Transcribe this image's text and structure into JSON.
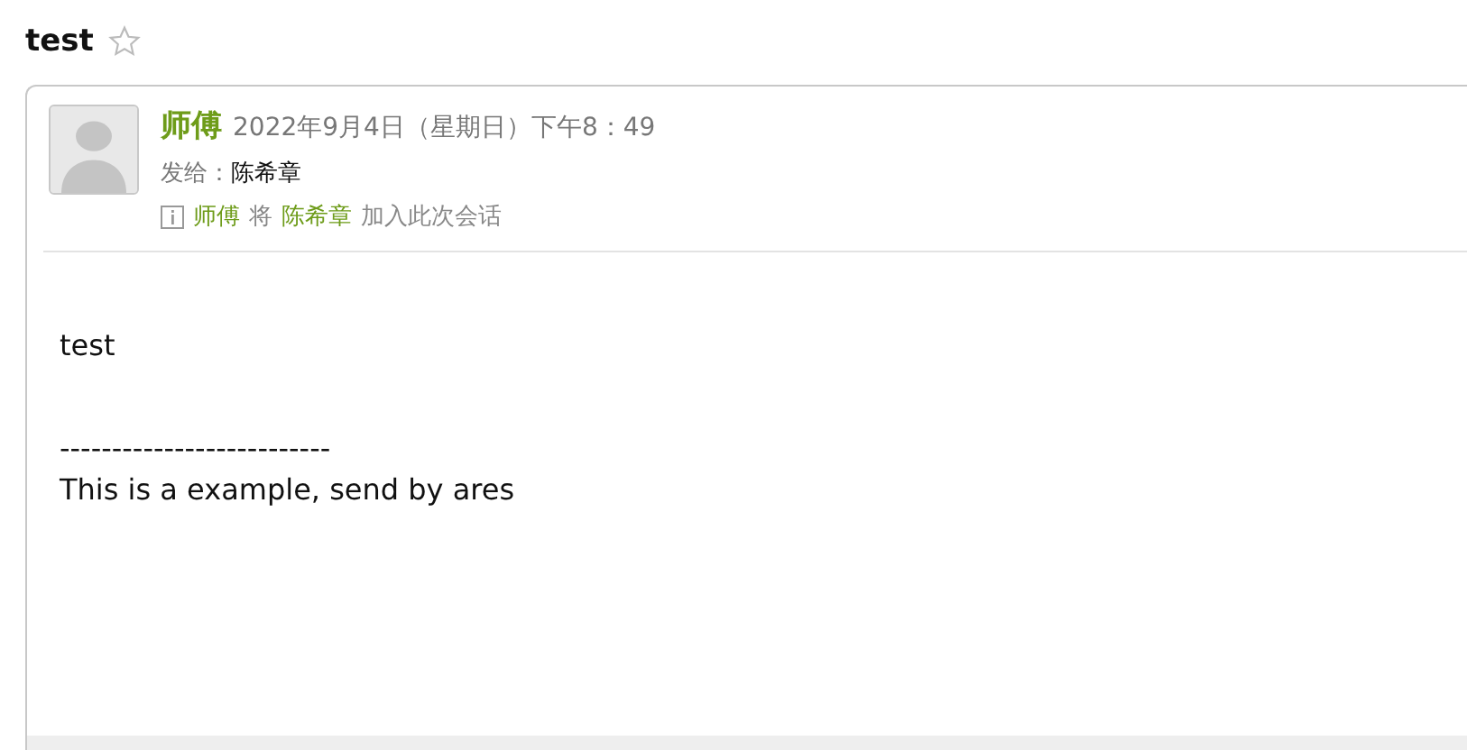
{
  "subject": "test",
  "starred": false,
  "message": {
    "sender": "师傅",
    "datetime": "2022年9月4日（星期日）下午8：49",
    "to_label": "发给：",
    "recipient": "陈希章",
    "notice": {
      "actor": "师傅",
      "verb": "将",
      "target": "陈希章",
      "action": "加入此次会话"
    },
    "body": [
      "test",
      "--------------------------",
      "This is a example, send by ares"
    ]
  }
}
